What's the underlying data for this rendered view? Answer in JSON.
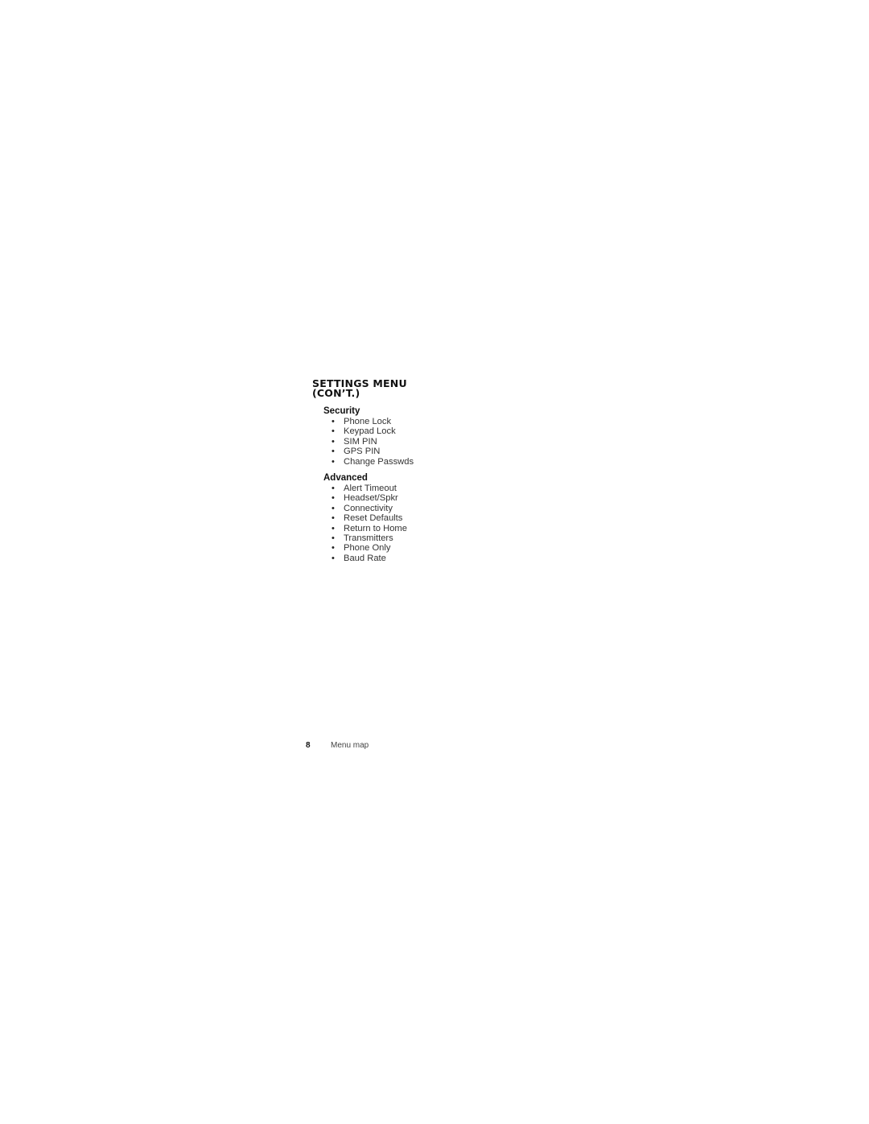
{
  "heading": {
    "line1": "SETTINGS MENU",
    "line2": "(CON’T.)"
  },
  "sections": [
    {
      "title": "Security",
      "items": [
        "Phone Lock",
        "Keypad Lock",
        "SIM PIN",
        "GPS PIN",
        "Change Passwds"
      ]
    },
    {
      "title": "Advanced",
      "items": [
        "Alert Timeout",
        "Headset/Spkr",
        "Connectivity",
        "Reset Defaults",
        "Return to Home",
        "Transmitters",
        "Phone Only",
        "Baud Rate"
      ]
    }
  ],
  "footer": {
    "page_number": "8",
    "section_label": "Menu map"
  },
  "bullet_glyph": "•"
}
